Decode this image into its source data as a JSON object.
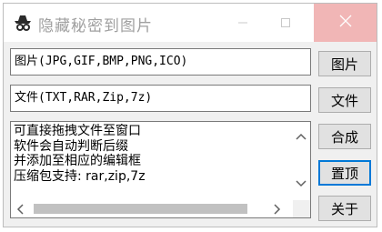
{
  "window": {
    "title": "隐藏秘密到图片"
  },
  "fields": {
    "image_path": "图片(JPG,GIF,BMP,PNG,ICO)",
    "file_path": "文件(TXT,RAR,Zip,7z)"
  },
  "memo": {
    "lines": [
      "可直接拖拽文件至窗口",
      "软件会自动判断后缀",
      "并添加至相应的编辑框",
      "压缩包支持: rar,zip,7z"
    ]
  },
  "buttons": {
    "image": "图片",
    "file": "文件",
    "combine": "合成",
    "topmost": "置顶",
    "about": "关于"
  },
  "colors": {
    "close_bg": "#f1b6b6",
    "accent": "#0078d7"
  },
  "icons": [
    "app-icon",
    "minimize-icon",
    "maximize-icon",
    "close-icon",
    "scroll-up-icon",
    "scroll-down-icon",
    "scroll-left-icon",
    "scroll-right-icon"
  ]
}
